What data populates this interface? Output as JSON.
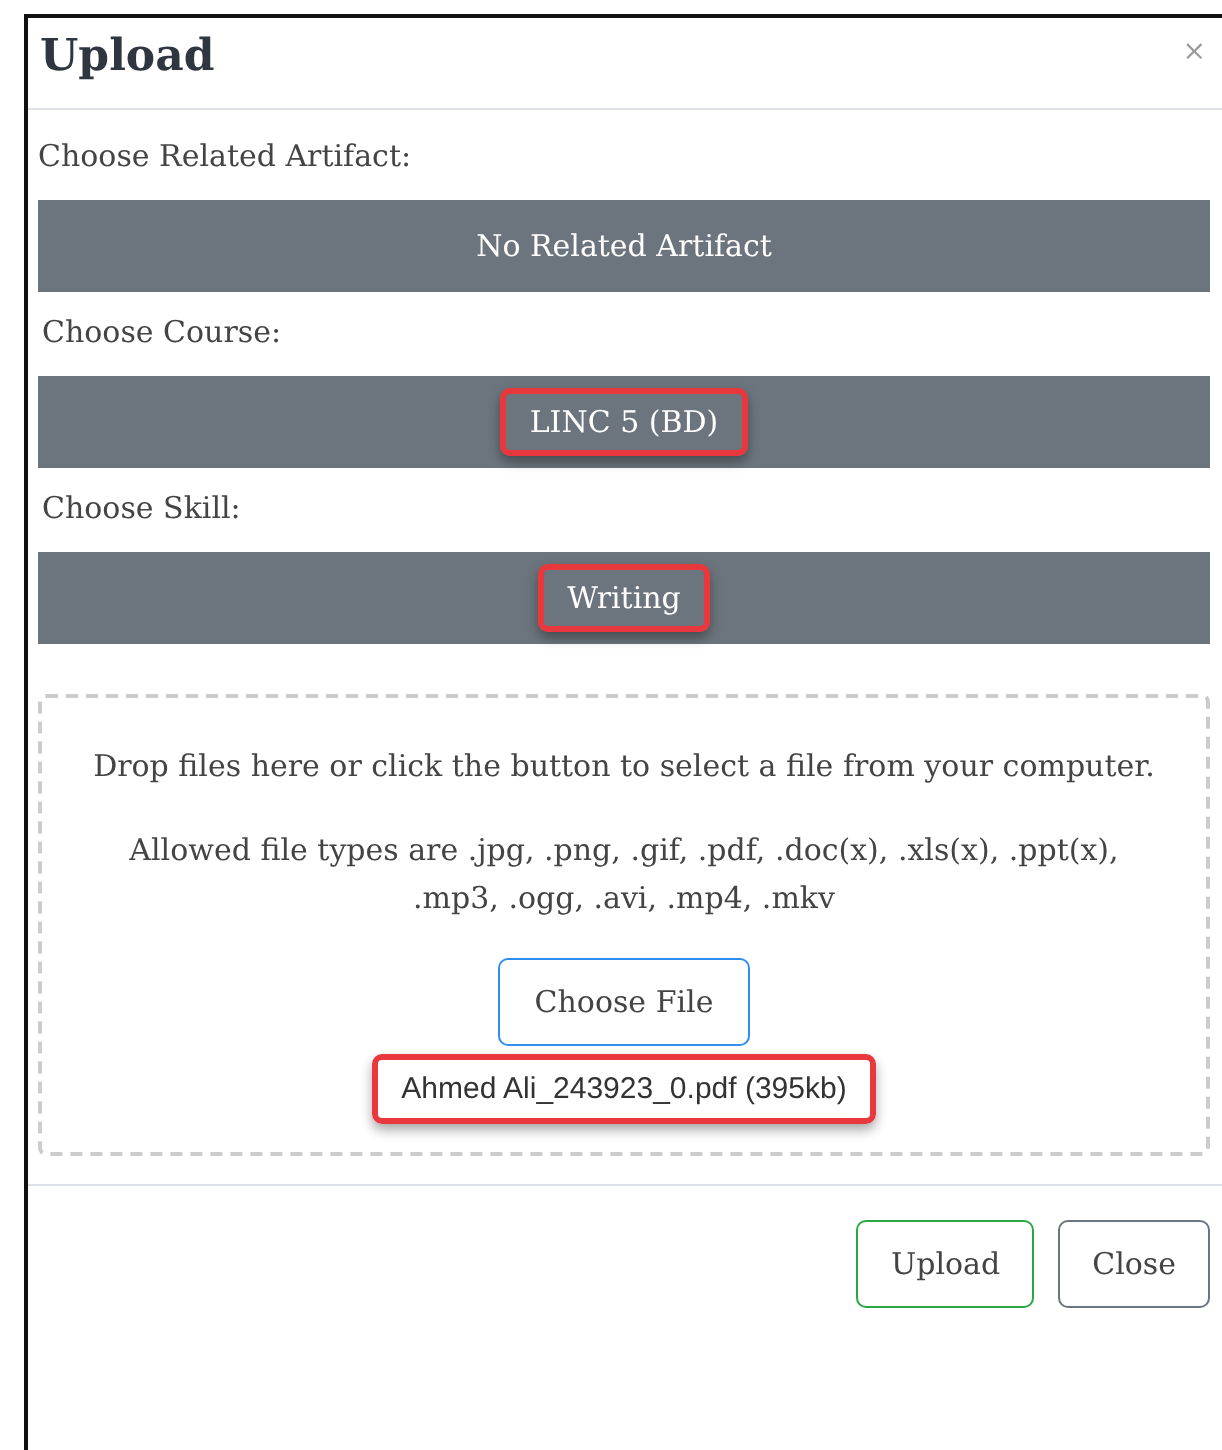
{
  "dialog": {
    "title": "Upload",
    "close_icon": "×"
  },
  "fields": [
    {
      "label": "Choose Related Artifact:",
      "value": "No Related Artifact",
      "highlighted": false
    },
    {
      "label": "Choose Course:",
      "value": "LINC 5 (BD)",
      "highlighted": true
    },
    {
      "label": "Choose Skill:",
      "value": "Writing",
      "highlighted": true
    }
  ],
  "dropzone": {
    "instructions": "Drop files here or click the button to select a file from your computer.",
    "allowed_types": "Allowed file types are .jpg, .png, .gif, .pdf, .doc(x), .xls(x), .ppt(x), .mp3, .ogg, .avi, .mp4, .mkv",
    "button": "Choose File",
    "file": {
      "name": "Ahmed Ali_243923_0.pdf (395kb)",
      "highlighted": true
    }
  },
  "buttons": [
    {
      "label": "Upload",
      "kind": "primary"
    },
    {
      "label": "Close",
      "kind": "secondary"
    }
  ]
}
